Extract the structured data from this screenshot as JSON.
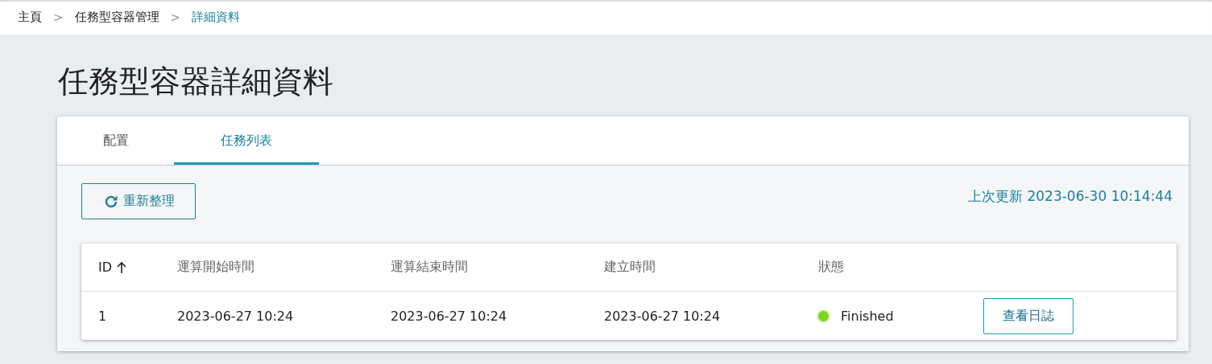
{
  "breadcrumb": [
    {
      "label": "主頁",
      "current": false
    },
    {
      "label": ">",
      "kind": "separator"
    },
    {
      "label": "任務型容器管理",
      "current": false
    },
    {
      "label": ">",
      "kind": "separator"
    },
    {
      "label": "詳細資料",
      "current": true
    }
  ],
  "title": "任務型容器詳細資料",
  "tabs": [
    {
      "label": "配置",
      "selected": false
    },
    {
      "label": "任務列表",
      "selected": true
    }
  ],
  "refresh_button": "重新整理",
  "last_updated": "上次更新 2023-06-30 10:14:44",
  "table": {
    "columns": [
      {
        "label": "ID",
        "sorted_ascending": true
      },
      {
        "label": "運算開始時間"
      },
      {
        "label": "運算結束時間"
      },
      {
        "label": "建立時間"
      },
      {
        "label": "狀態"
      }
    ],
    "rows": [
      {
        "id": "1",
        "start": "2023-06-27 10:24",
        "end": "2023-06-27 10:24",
        "created": "2023-06-27 10:24",
        "status": "Finished",
        "color": "#7ed321",
        "action": "查看日誌"
      }
    ]
  }
}
